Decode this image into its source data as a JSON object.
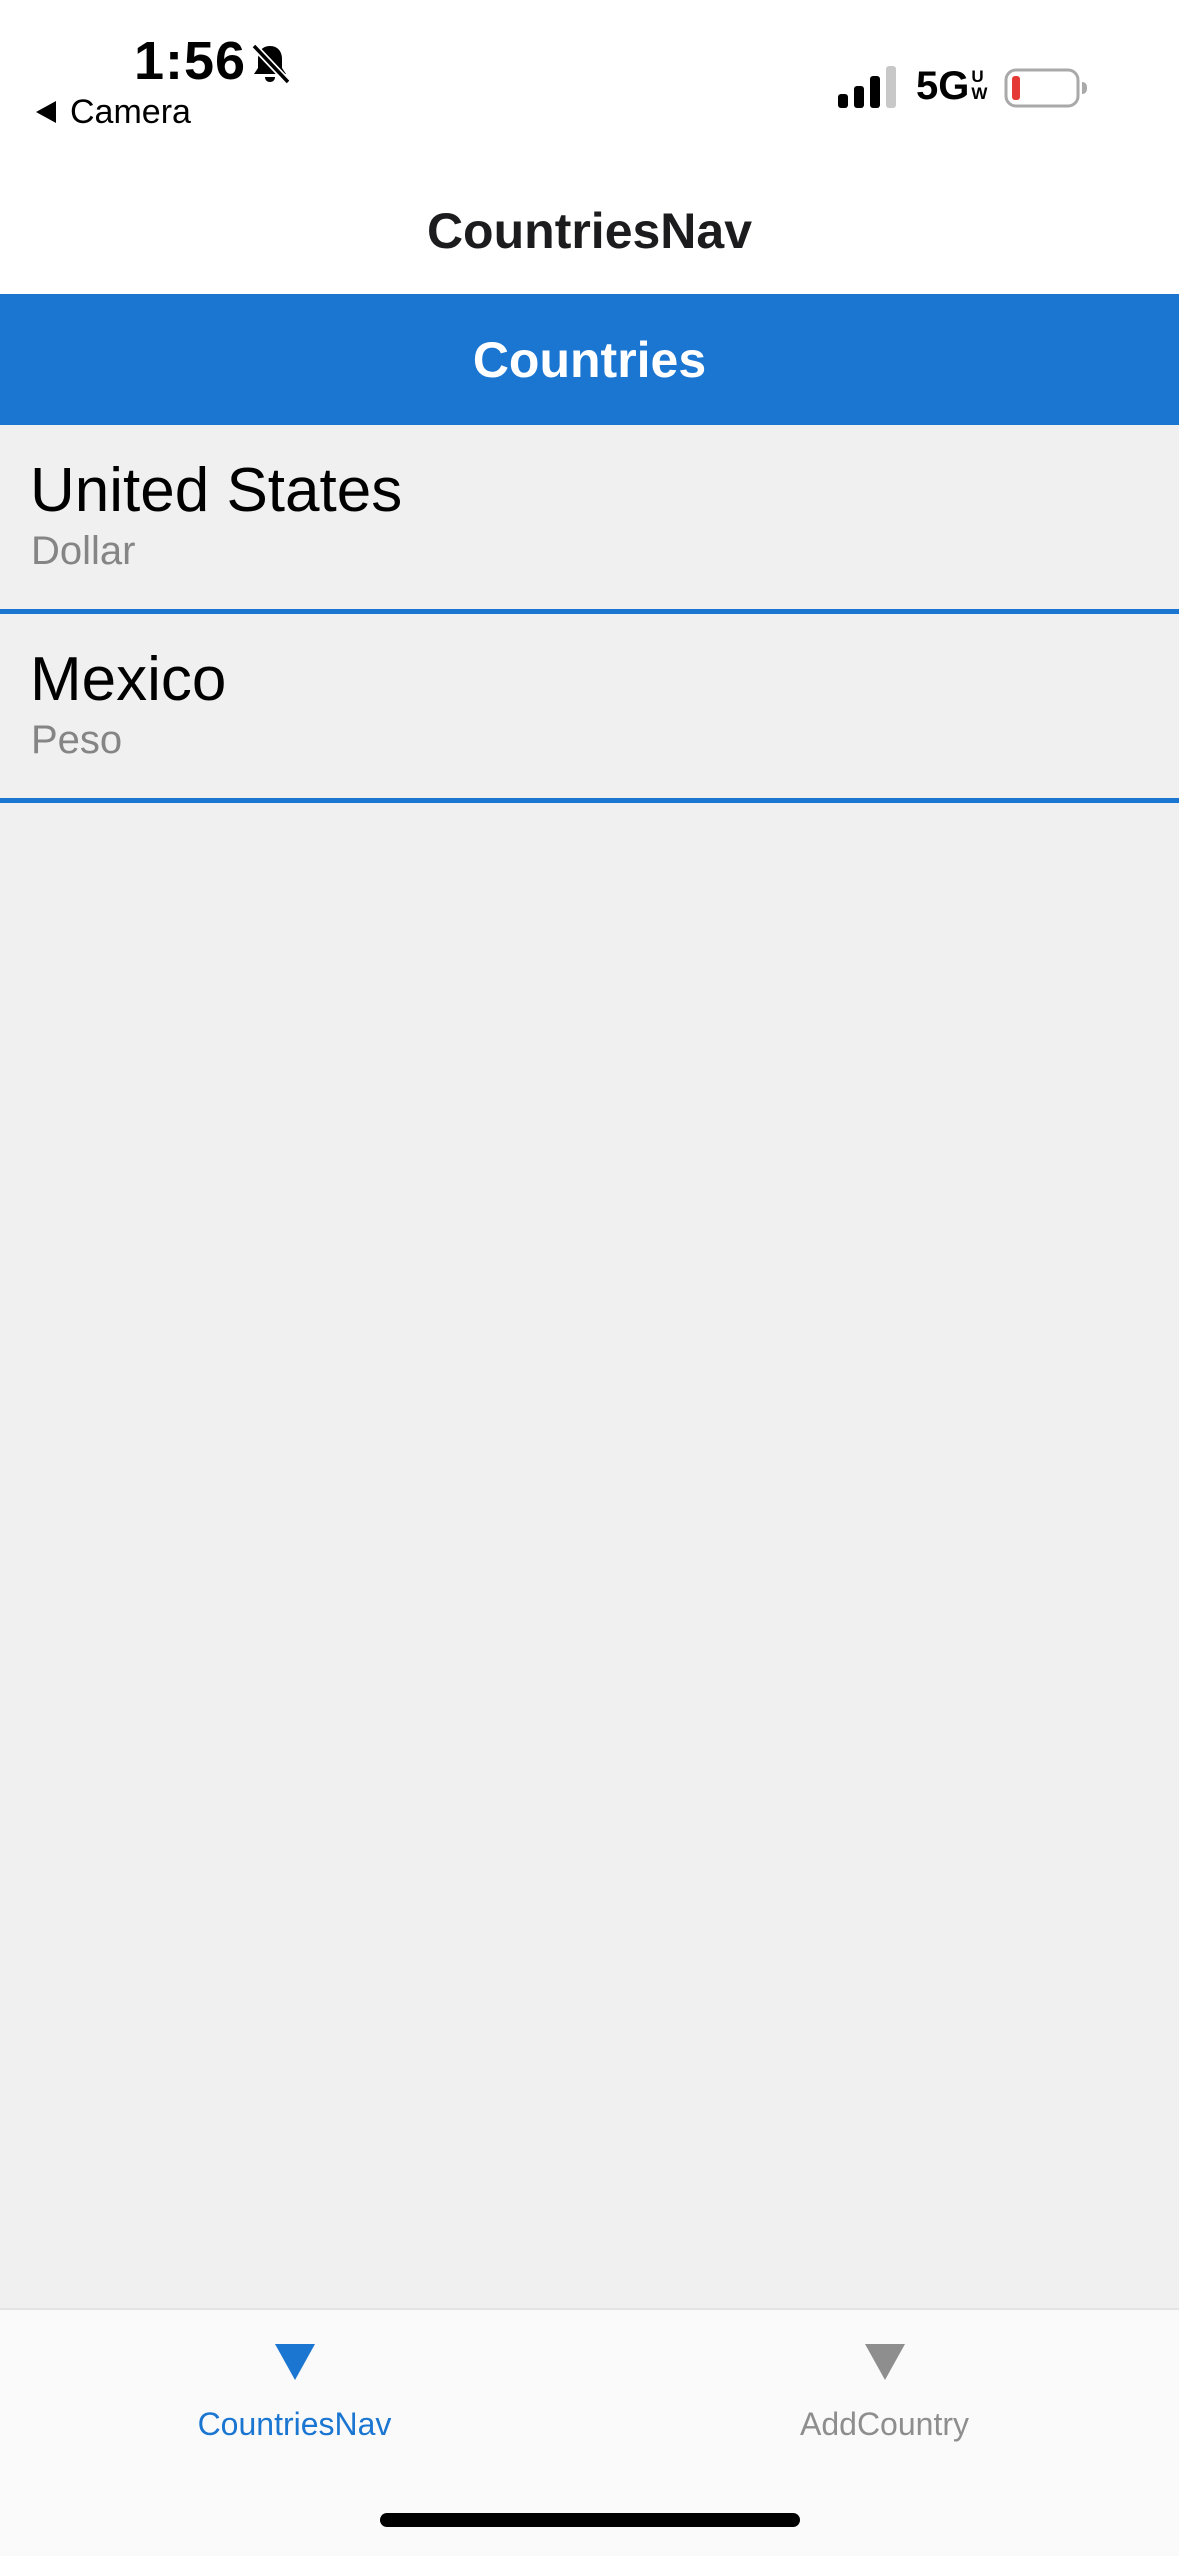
{
  "status_bar": {
    "time": "1:56",
    "back_label": "Camera",
    "network": "5G",
    "network_badge_top": "U",
    "network_badge_bottom": "W",
    "battery_color": "#e53935"
  },
  "nav": {
    "title": "CountriesNav"
  },
  "list_header": {
    "title": "Countries"
  },
  "countries": [
    {
      "name": "United States",
      "currency": "Dollar"
    },
    {
      "name": "Mexico",
      "currency": "Peso"
    }
  ],
  "tabs": [
    {
      "label": "CountriesNav",
      "icon": "triangle-down-icon",
      "active": true
    },
    {
      "label": "AddCountry",
      "icon": "triangle-down-icon",
      "active": false
    }
  ],
  "colors": {
    "accent": "#1b76d2",
    "background": "#f0f0f0",
    "inactive": "#8e8e8e"
  }
}
